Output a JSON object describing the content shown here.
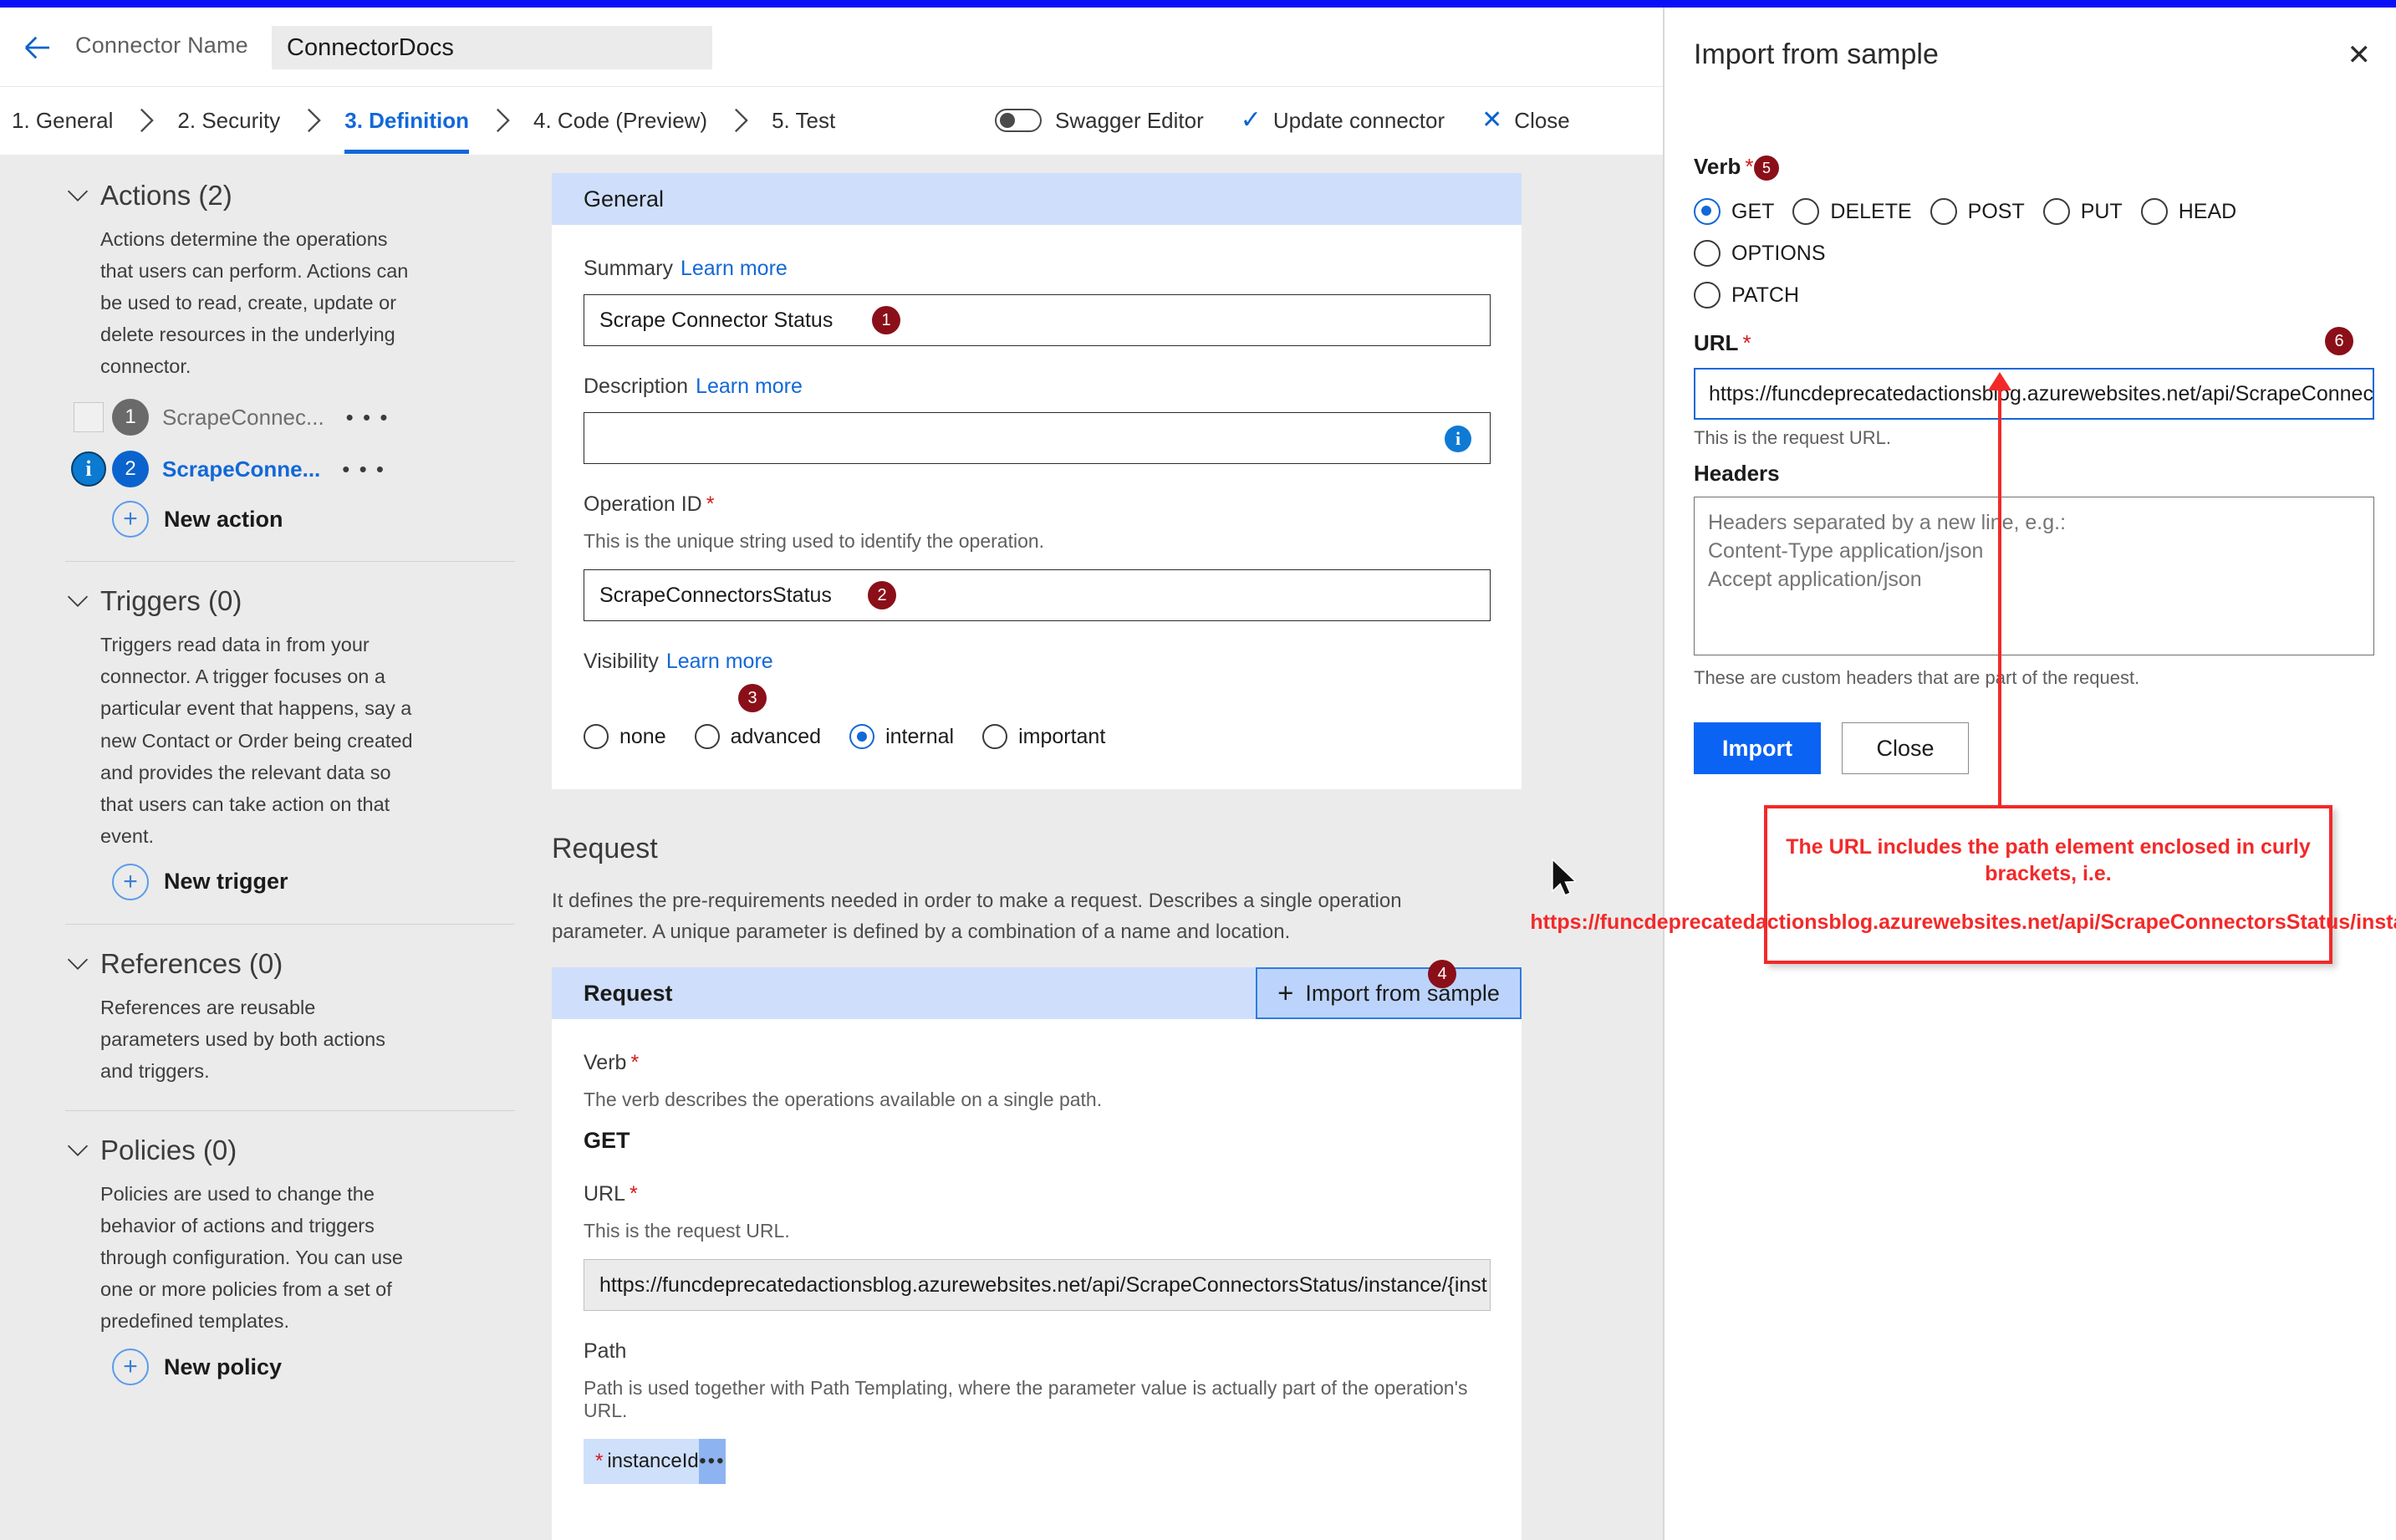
{
  "header": {
    "back_icon": "back-arrow-icon",
    "connector_label": "Connector Name",
    "connector_name_value": "ConnectorDocs"
  },
  "breadcrumb": {
    "steps": [
      {
        "label": "1. General",
        "active": false
      },
      {
        "label": "2. Security",
        "active": false
      },
      {
        "label": "3. Definition",
        "active": true
      },
      {
        "label": "4. Code (Preview)",
        "active": false
      },
      {
        "label": "5. Test",
        "active": false
      }
    ]
  },
  "toolbar": {
    "swagger_toggle_label": "Swagger Editor",
    "update_label": "Update connector",
    "update_icon": "check-icon",
    "close_label": "Close",
    "close_icon": "x-icon"
  },
  "sidebar": {
    "sections": [
      {
        "title": "Actions (2)",
        "description": "Actions determine the operations that users can perform. Actions can be used to read, create, update or delete resources in the underlying connector.",
        "items": [
          {
            "num": "1",
            "name": "ScrapeConnec...",
            "selected": false,
            "menu": "• • •"
          },
          {
            "num": "2",
            "name": "ScrapeConne...",
            "selected": true,
            "menu": "• • •"
          }
        ],
        "new_label": "New action"
      },
      {
        "title": "Triggers (0)",
        "description": "Triggers read data in from your connector. A trigger focuses on a particular event that happens, say a new Contact or Order being created and provides the relevant data so that users can take action on that event.",
        "items": [],
        "new_label": "New trigger"
      },
      {
        "title": "References (0)",
        "description": "References are reusable parameters used by both actions and triggers.",
        "items": [],
        "new_label": ""
      },
      {
        "title": "Policies (0)",
        "description": "Policies are used to change the behavior of actions and triggers through configuration. You can use one or more policies from a set of predefined templates.",
        "items": [],
        "new_label": "New policy"
      }
    ]
  },
  "general_card": {
    "header": "General",
    "summary": {
      "label": "Summary",
      "learn_more": "Learn more",
      "value": "Scrape Connector Status",
      "badge": "1"
    },
    "description": {
      "label": "Description",
      "learn_more": "Learn more",
      "value": "",
      "info_icon": "info-icon"
    },
    "operation_id": {
      "label": "Operation ID",
      "required": "*",
      "help": "This is the unique string used to identify the operation.",
      "value": "ScrapeConnectorsStatus",
      "badge": "2"
    },
    "visibility": {
      "label": "Visibility",
      "learn_more": "Learn more",
      "badge": "3",
      "options": [
        {
          "label": "none",
          "selected": false
        },
        {
          "label": "advanced",
          "selected": false
        },
        {
          "label": "internal",
          "selected": true
        },
        {
          "label": "important",
          "selected": false
        }
      ]
    }
  },
  "request_section": {
    "title": "Request",
    "description": "It defines the pre-requirements needed in order to make a request. Describes a single operation parameter. A unique parameter is defined by a combination of a name and location.",
    "badge": "4",
    "card_header": "Request",
    "import_button": "Import from sample",
    "import_button_icon": "plus-icon",
    "verb": {
      "label": "Verb",
      "required": "*",
      "help": "The verb describes the operations available on a single path.",
      "value": "GET"
    },
    "url": {
      "label": "URL",
      "required": "*",
      "help": "This is the request URL.",
      "value": "https://funcdeprecatedactionsblog.azurewebsites.net/api/ScrapeConnectorsStatus/instance/{inst"
    },
    "path": {
      "label": "Path",
      "help": "Path is used together with Path Templating, where the parameter value is actually part of the operation's URL.",
      "chip_required": "*",
      "chip_label": "instanceId",
      "chip_menu": "•••"
    }
  },
  "import_panel": {
    "title": "Import from sample",
    "close_icon": "close-icon",
    "verb": {
      "label": "Verb",
      "required": "*",
      "badge": "5",
      "options": [
        {
          "label": "GET",
          "selected": true
        },
        {
          "label": "DELETE",
          "selected": false
        },
        {
          "label": "POST",
          "selected": false
        },
        {
          "label": "PUT",
          "selected": false
        },
        {
          "label": "HEAD",
          "selected": false
        },
        {
          "label": "OPTIONS",
          "selected": false
        },
        {
          "label": "PATCH",
          "selected": false
        }
      ]
    },
    "url": {
      "label": "URL",
      "required": "*",
      "badge": "6",
      "value": "https://funcdeprecatedactionsblog.azurewebsites.net/api/ScrapeConnec",
      "help": "This is the request URL."
    },
    "headers": {
      "label": "Headers",
      "placeholder": "Headers separated by a new line, e.g.:\nContent-Type application/json\nAccept application/json",
      "help": "These are custom headers that are part of the request."
    },
    "buttons": {
      "import": "Import",
      "close": "Close"
    }
  },
  "callout": {
    "line1": "The URL includes the path element enclosed in curly brackets, i.e.",
    "line2": "https://funcdeprecatedactionsblog.azurewebsites.net/api/ScrapeConnectorsStatus/instance/{instanceId}",
    "border_color": "#f32929"
  },
  "cursor": {
    "icon": "mouse-pointer-icon"
  }
}
